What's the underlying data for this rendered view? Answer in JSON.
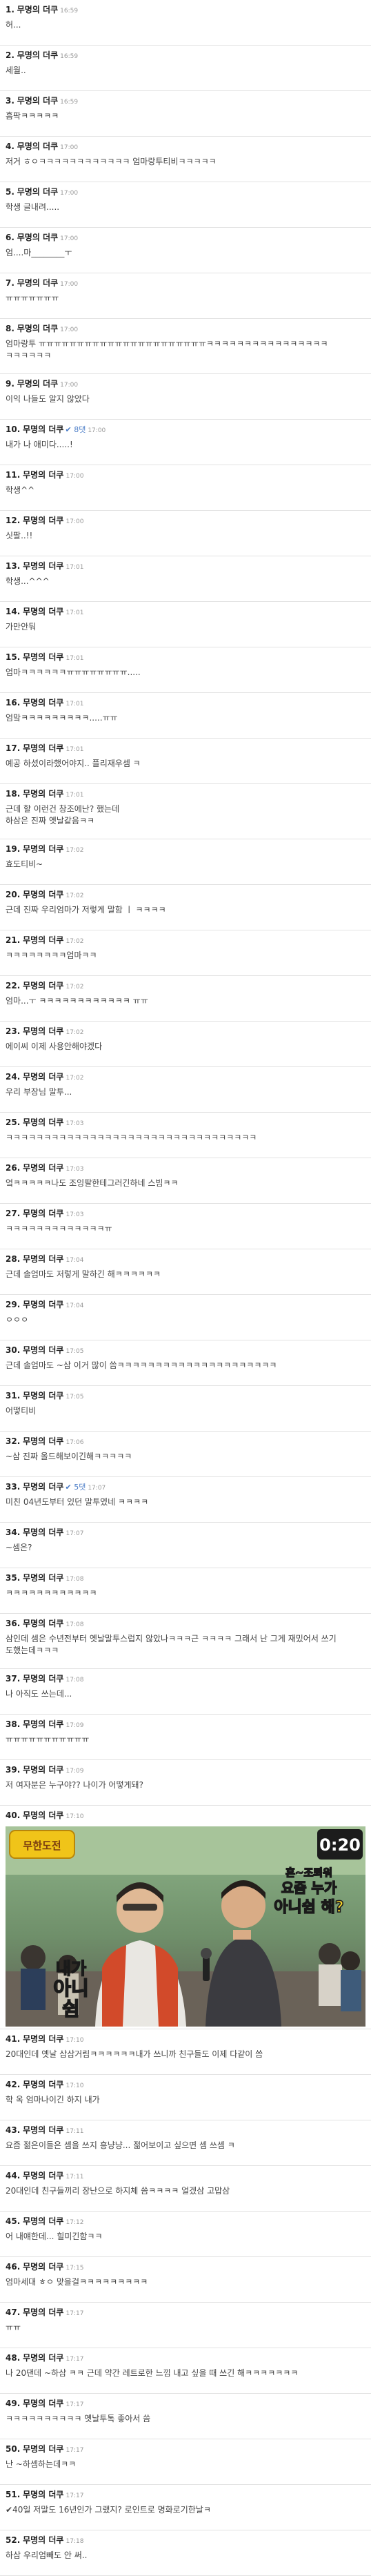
{
  "comments": [
    {
      "number": "1.",
      "author": "무명의 더쿠",
      "time": "16:59",
      "best": "",
      "body": [
        "허..."
      ]
    },
    {
      "number": "2.",
      "author": "무명의 더쿠",
      "time": "16:59",
      "best": "",
      "body": [
        "세월.."
      ]
    },
    {
      "number": "3.",
      "author": "무명의 더쿠",
      "time": "16:59",
      "best": "",
      "body": [
        "흠팍ㅋㅋㅋㅋㅋ"
      ]
    },
    {
      "number": "4.",
      "author": "무명의 더쿠",
      "time": "17:00",
      "best": "",
      "body": [
        "저거 ㅎㅇㅋㅋㅋㅋㅋㅋㅋㅋㅋㅋㅋㅋ 엄마랑투티비ㅋㅋㅋㅋㅋ"
      ]
    },
    {
      "number": "5.",
      "author": "무명의 더쿠",
      "time": "17:00",
      "best": "",
      "body": [
        "학생 글내려....."
      ]
    },
    {
      "number": "6.",
      "author": "무명의 더쿠",
      "time": "17:00",
      "best": "",
      "body": [
        "엄....마________ㅜ"
      ]
    },
    {
      "number": "7.",
      "author": "무명의 더쿠",
      "time": "17:00",
      "best": "",
      "body": [
        "ㅠㅠㅠㅠㅠㅠㅠ"
      ]
    },
    {
      "number": "8.",
      "author": "무명의 더쿠",
      "time": "17:00",
      "best": "",
      "body": [
        "엄마랑투 ㅠㅠㅠㅠㅠㅠㅠㅠㅠㅠㅠㅠㅠㅠㅠㅠㅠㅠㅠㅠㅠㅠㅋㅋㅋㅋㅋㅋㅋㅋㅋㅋㅋㅋㅋㅋㅋㅋ",
        "ㅋㅋㅋㅋㅋㅋ"
      ]
    },
    {
      "number": "9.",
      "author": "무명의 더쿠",
      "time": "17:00",
      "best": "",
      "body": [
        "이익 나들도 알지 않았다"
      ]
    },
    {
      "number": "10.",
      "author": "무명의 더쿠",
      "time": "17:00",
      "best": "✔ 8댓",
      "body": [
        "내가 나 애미다.....!"
      ]
    },
    {
      "number": "11.",
      "author": "무명의 더쿠",
      "time": "17:00",
      "best": "",
      "body": [
        "학생^^"
      ]
    },
    {
      "number": "12.",
      "author": "무명의 더쿠",
      "time": "17:00",
      "best": "",
      "body": [
        "싯팔..!!"
      ]
    },
    {
      "number": "13.",
      "author": "무명의 더쿠",
      "time": "17:01",
      "best": "",
      "body": [
        "학생...^^^"
      ]
    },
    {
      "number": "14.",
      "author": "무명의 더쿠",
      "time": "17:01",
      "best": "",
      "body": [
        "가만안둬"
      ]
    },
    {
      "number": "15.",
      "author": "무명의 더쿠",
      "time": "17:01",
      "best": "",
      "body": [
        "엄마ㅋㅋㅋㅋㅋㅋㅠㅠㅠㅠㅠㅠㅠㅠ....."
      ]
    },
    {
      "number": "16.",
      "author": "무명의 더쿠",
      "time": "17:01",
      "best": "",
      "body": [
        "엄맠ㅋㅋㅋㅋㅋㅋㅋㅋㅋ.....ㅠㅠ"
      ]
    },
    {
      "number": "17.",
      "author": "무명의 더쿠",
      "time": "17:01",
      "best": "",
      "body": [
        "예공 하셨이라했어야지.. 플리재우셈 ㅋ"
      ]
    },
    {
      "number": "18.",
      "author": "무명의 더쿠",
      "time": "17:01",
      "best": "",
      "body": [
        "근데 할 이런건 창조에난? 했는데",
        "하삼은 진짜 옛날같음ㅋㅋ"
      ]
    },
    {
      "number": "19.",
      "author": "무명의 더쿠",
      "time": "17:02",
      "best": "",
      "body": [
        "효도티비~"
      ]
    },
    {
      "number": "20.",
      "author": "무명의 더쿠",
      "time": "17:02",
      "best": "",
      "body": [
        "근데 진짜 우리엄마가 저렇게 말함 ㅣ ㅋㅋㅋㅋ"
      ]
    },
    {
      "number": "21.",
      "author": "무명의 더쿠",
      "time": "17:02",
      "best": "",
      "body": [
        "ㅋㅋㅋㅋㅋㅋㅋㅋ엄마ㅋㅋ"
      ]
    },
    {
      "number": "22.",
      "author": "무명의 더쿠",
      "time": "17:02",
      "best": "",
      "body": [
        "엄마...ㅜ ㅋㅋㅋㅋㅋㅋㅋㅋㅋㅋㅋㅋ ㅠㅠ"
      ]
    },
    {
      "number": "23.",
      "author": "무명의 더쿠",
      "time": "17:02",
      "best": "",
      "body": [
        "에이씨 이제 사용안해야겠다"
      ]
    },
    {
      "number": "24.",
      "author": "무명의 더쿠",
      "time": "17:02",
      "best": "",
      "body": [
        "우리 부장님 말투..."
      ]
    },
    {
      "number": "25.",
      "author": "무명의 더쿠",
      "time": "17:03",
      "best": "",
      "body": [
        "ㅋㅋㅋㅋㅋㅋㅋㅋㅋㅋㅋㅋㅋㅋㅋㅋㅋㅋㅋㅋㅋㅋㅋㅋㅋㅋㅋㅋㅋㅋㅋㅋㅋ"
      ]
    },
    {
      "number": "26.",
      "author": "무명의 더쿠",
      "time": "17:03",
      "best": "",
      "body": [
        "엌ㅋㅋㅋㅋㅋ나도 조잉팔한테그러긴하네 스빔ㅋㅋ"
      ]
    },
    {
      "number": "27.",
      "author": "무명의 더쿠",
      "time": "17:03",
      "best": "",
      "body": [
        "ㅋㅋㅋㅋㅋㅋㅋㅋㅋㅋㅋㅋㅋㅠ"
      ]
    },
    {
      "number": "28.",
      "author": "무명의 더쿠",
      "time": "17:04",
      "best": "",
      "body": [
        "근데 솔엄마도 저렇게 말하긴 해ㅋㅋㅋㅋㅋㅋ"
      ]
    },
    {
      "number": "29.",
      "author": "무명의 더쿠",
      "time": "17:04",
      "best": "",
      "body": [
        "ㅇㅇㅇ"
      ]
    },
    {
      "number": "30.",
      "author": "무명의 더쿠",
      "time": "17:05",
      "best": "",
      "body": [
        "근데 솔엄마도 ~삼 이거 많이 씀ㅋㅋㅋㅋㅋㅋㅋㅋㅋㅋㅋㅋㅋㅋㅋㅋㅋㅋㅋㅋㅋ"
      ]
    },
    {
      "number": "31.",
      "author": "무명의 더쿠",
      "time": "17:05",
      "best": "",
      "body": [
        "어떻티비"
      ]
    },
    {
      "number": "32.",
      "author": "무명의 더쿠",
      "time": "17:06",
      "best": "",
      "body": [
        "~삼 진짜 올드해보이긴해ㅋㅋㅋㅋㅋ"
      ]
    },
    {
      "number": "33.",
      "author": "무명의 더쿠",
      "time": "17:07",
      "best": "✔ 5댓",
      "body": [
        "미친 04년도부터 있던 말투였네 ㅋㅋㅋㅋ"
      ]
    },
    {
      "number": "34.",
      "author": "무명의 더쿠",
      "time": "17:07",
      "best": "",
      "body": [
        "~셈은?"
      ]
    },
    {
      "number": "35.",
      "author": "무명의 더쿠",
      "time": "17:08",
      "best": "",
      "body": [
        "ㅋㅋㅋㅋㅋㅋㅋㅋㅋㅋㅋㅋ"
      ]
    },
    {
      "number": "36.",
      "author": "무명의 더쿠",
      "time": "17:08",
      "best": "",
      "body": [
        "삼인데 셈은 수년전부터 옛날말투스럽지 않았나ㅋㅋㅋ근 ㅋㅋㅋㅋ 그래서 난 그게 재밌어서 쓰기",
        "도했는데ㅋㅋㅋ"
      ]
    },
    {
      "number": "37.",
      "author": "무명의 더쿠",
      "time": "17:08",
      "best": "",
      "body": [
        "나 아직도 쓰는데..."
      ]
    },
    {
      "number": "38.",
      "author": "무명의 더쿠",
      "time": "17:09",
      "best": "",
      "body": [
        "ㅠㅠㅠㅠㅠㅠㅠㅠㅠㅠㅠ"
      ]
    },
    {
      "number": "39.",
      "author": "무명의 더쿠",
      "time": "17:09",
      "best": "",
      "body": [
        "저 여자분은 누구야?? 나이가 어떻게돼?"
      ]
    },
    {
      "number": "40.",
      "author": "무명의 더쿠",
      "time": "17:10",
      "best": "",
      "body": []
    },
    {
      "number": "41.",
      "author": "무명의 더쿠",
      "time": "17:10",
      "best": "",
      "body": [
        "20대인데 옛날 삼삼거림ㅋㅋㅋㅋㅋㅋ내가 쓰니까 친구들도 이제 다같이 씀"
      ]
    },
    {
      "number": "42.",
      "author": "무명의 더쿠",
      "time": "17:10",
      "best": "",
      "body": [
        "학 옥 엄마나이긴 하지 내가"
      ]
    },
    {
      "number": "43.",
      "author": "무명의 더쿠",
      "time": "17:11",
      "best": "",
      "body": [
        "요즘 젊은이들은 셈을 쓰지 흥냥냥... 젊어보이고 싶으면 셈 쓰셈 ㅋ"
      ]
    },
    {
      "number": "44.",
      "author": "무명의 더쿠",
      "time": "17:11",
      "best": "",
      "body": [
        "20대인데 친구들끼리 장난으로 하지체 씀ㅋㅋㅋㅋ 얼겠삼 고맙삼"
      ]
    },
    {
      "number": "45.",
      "author": "무명의 더쿠",
      "time": "17:12",
      "best": "",
      "body": [
        "어 내얘한데... 힐미긴함ㅋㅋ"
      ]
    },
    {
      "number": "46.",
      "author": "무명의 더쿠",
      "time": "17:15",
      "best": "",
      "body": [
        "엄마세대 ㅎㅇ 맞을걸ㅋㅋㅋㅋㅋㅋㅋㅋㅋ"
      ]
    },
    {
      "number": "47.",
      "author": "무명의 더쿠",
      "time": "17:17",
      "best": "",
      "body": [
        "ㅠㅠ"
      ]
    },
    {
      "number": "48.",
      "author": "무명의 더쿠",
      "time": "17:17",
      "best": "",
      "body": [
        "나 20댄데 ~하삼 ㅋㅋ 근데 약간 레트로한 느낌 내고 싶을 때 쓰긴 해ㅋㅋㅋㅋㅋㅋㅋ"
      ]
    },
    {
      "number": "49.",
      "author": "무명의 더쿠",
      "time": "17:17",
      "best": "",
      "body": [
        "ㅋㅋㅋㅋㅋㅋㅋㅋㅋㅋ 옛날투톡 좋아서 씀"
      ]
    },
    {
      "number": "50.",
      "author": "무명의 더쿠",
      "time": "17:17",
      "best": "",
      "body": [
        "난 ~하셈하는데ㅋㅋ"
      ]
    },
    {
      "number": "51.",
      "author": "무명의 더쿠",
      "time": "17:17",
      "best": "",
      "body": [
        "✔40일 저말도 16년인가 그랬지? 로인트로 명화로기한날ㅋ"
      ]
    },
    {
      "number": "52.",
      "author": "무명의 더쿠",
      "time": "17:18",
      "best": "",
      "body": [
        "하삼 우리엄빼도 안 써.."
      ]
    }
  ],
  "photo": {
    "show_logo": "무한도전",
    "timer": "0:20",
    "caption_left": [
      "내가",
      "아니",
      "쉼"
    ],
    "caption_right_top": "혼~조뢰워",
    "caption_right": [
      "요즘 누가",
      "아니쉼 해?"
    ]
  },
  "colors": {
    "author": "#222222",
    "best_badge": "#4a7cc7",
    "time": "#999999",
    "divider": "#e2e2e2",
    "timer_bg": "#1c1c1c",
    "caption_left": "#f4d22a",
    "caption_right": "#f4d22a"
  },
  "icons": {
    "best_badge": "check-icon"
  }
}
